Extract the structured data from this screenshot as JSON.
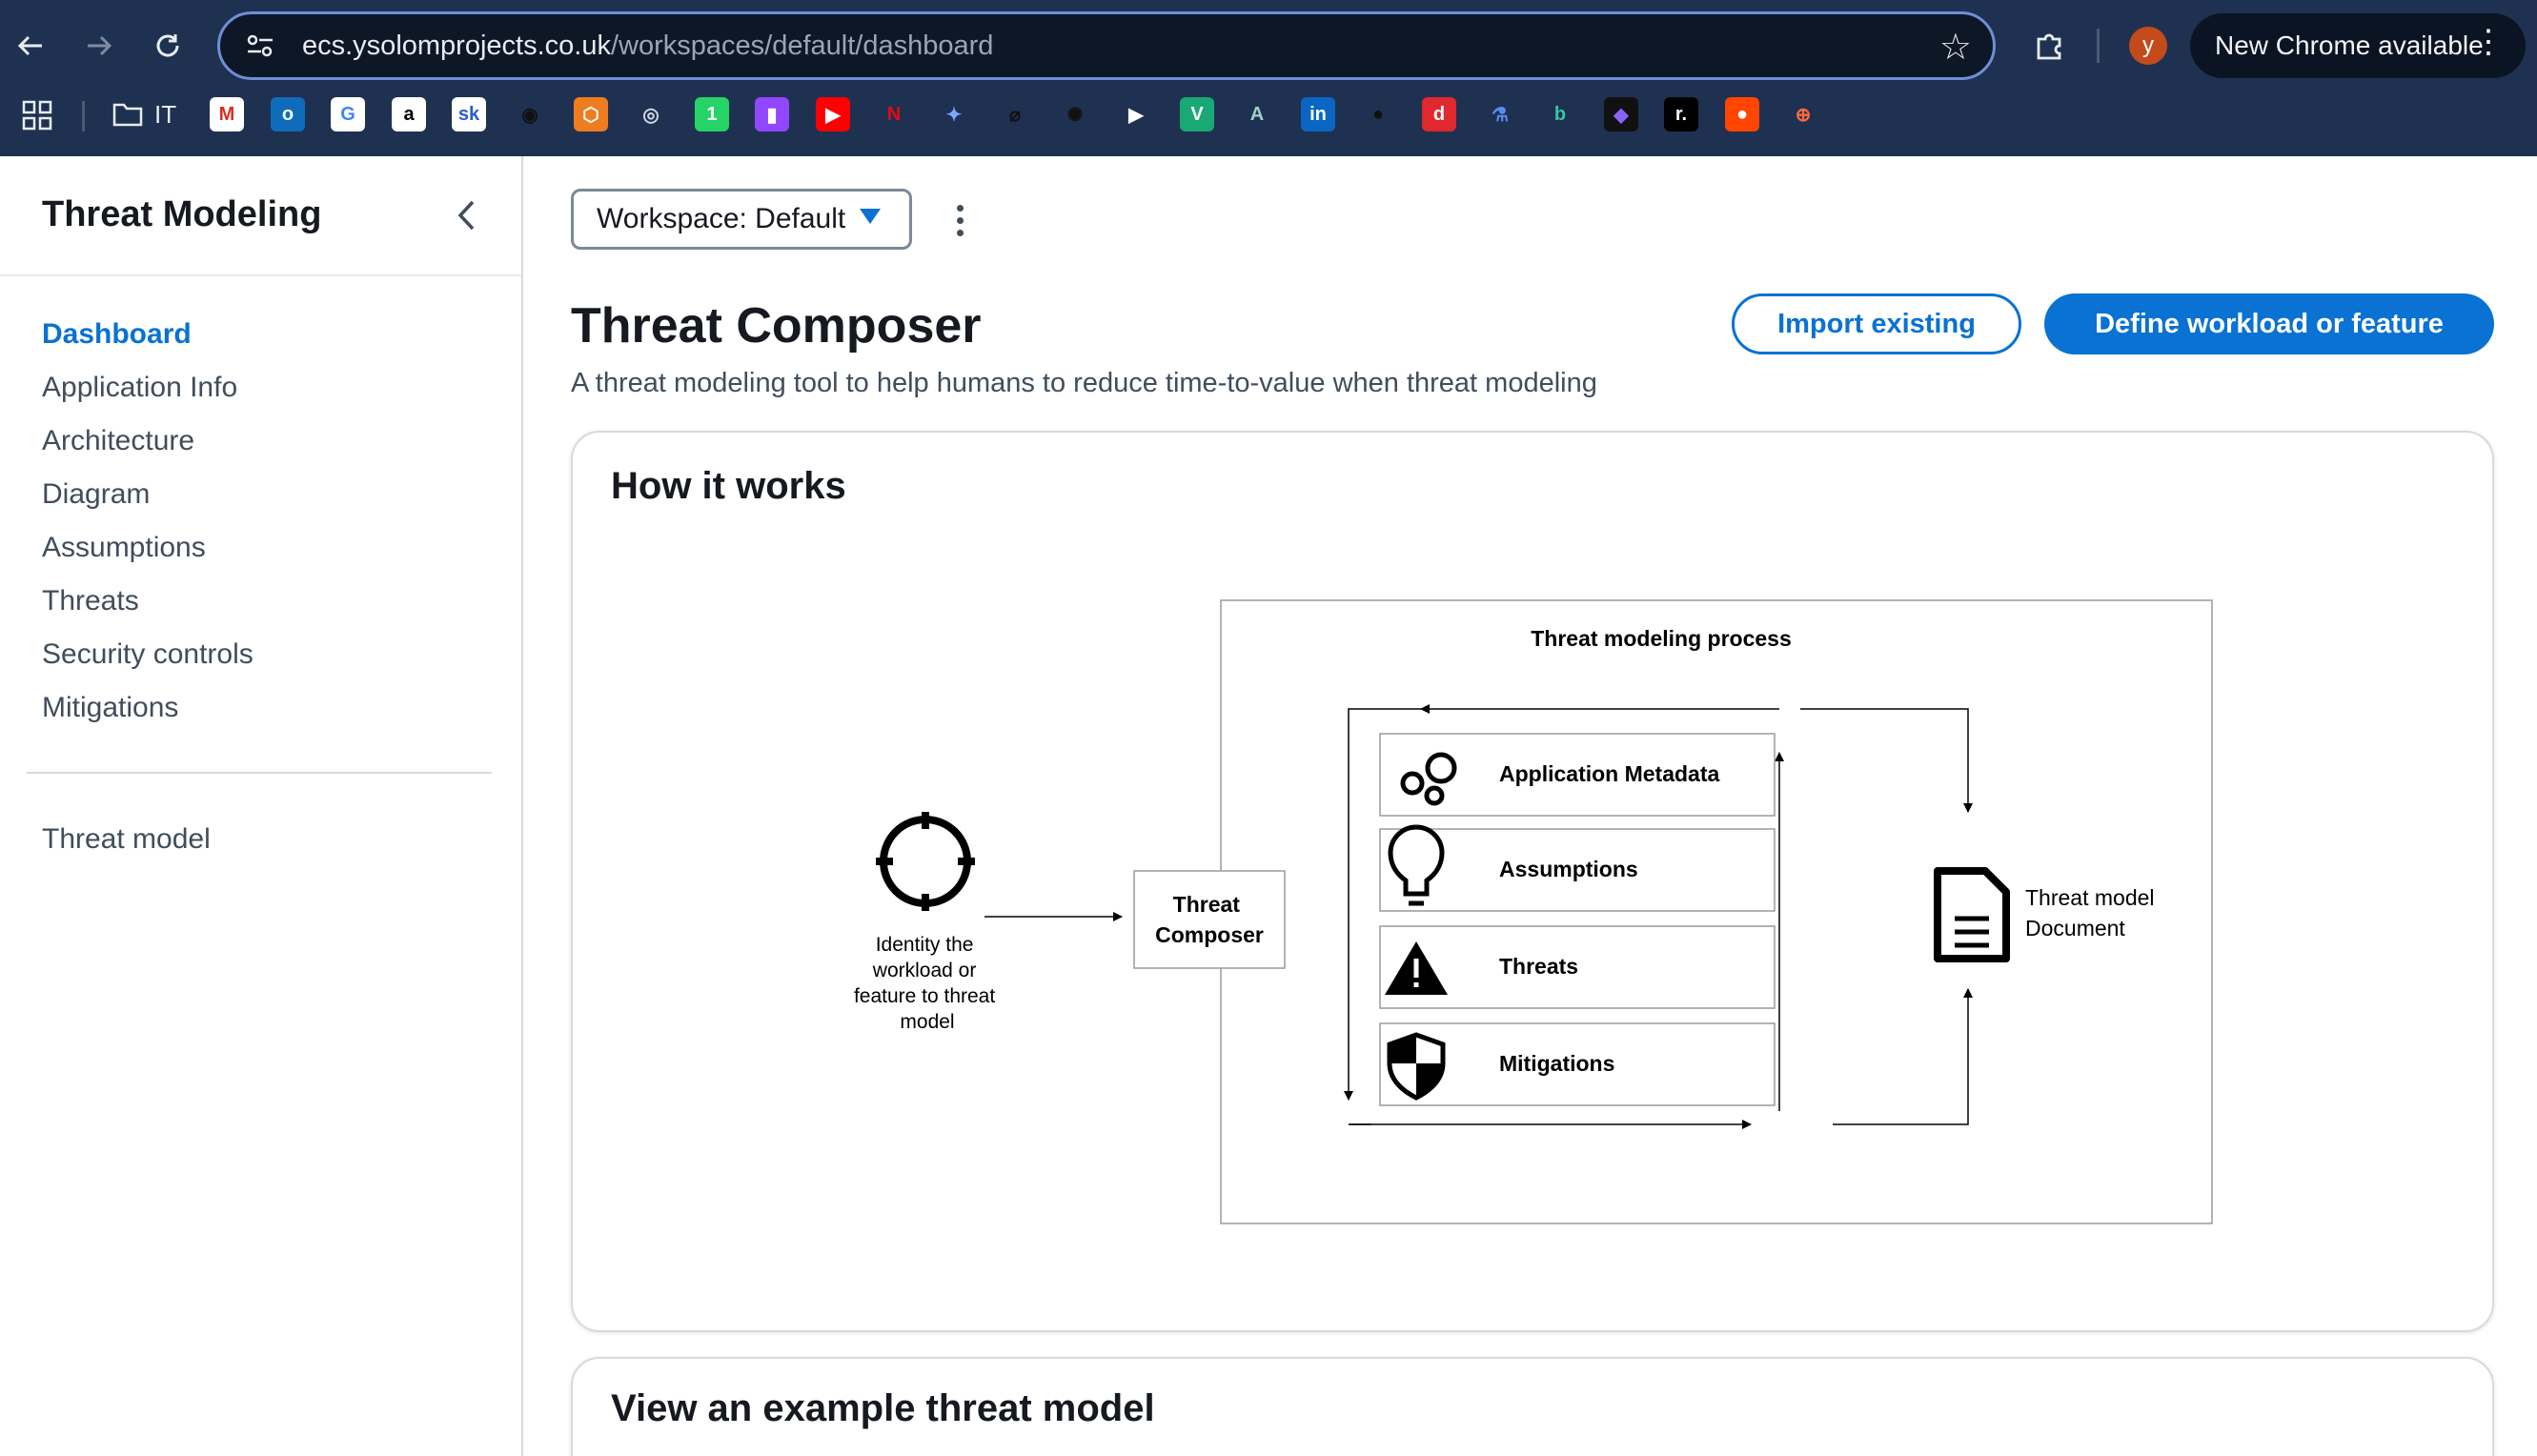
{
  "browser": {
    "url_host": "ecs.ysolomprojects.co.uk",
    "url_path": "/workspaces/default/dashboard",
    "profile_initial": "y",
    "update_label": "New Chrome available",
    "bookmark_folder": "IT",
    "bookmarks": [
      {
        "name": "gmail",
        "glyph": "M",
        "color": "#ffffff",
        "fg": "#d93025"
      },
      {
        "name": "outlook",
        "glyph": "o",
        "color": "#0f6cbd",
        "fg": "#ffffff"
      },
      {
        "name": "google",
        "glyph": "G",
        "color": "#ffffff",
        "fg": "#4285f4"
      },
      {
        "name": "amazon",
        "glyph": "a",
        "color": "#ffffff",
        "fg": "#000000"
      },
      {
        "name": "skool",
        "glyph": "sk",
        "color": "#ffffff",
        "fg": "#2a5bd7"
      },
      {
        "name": "github",
        "glyph": "◉",
        "color": "#1f3150",
        "fg": "#111111"
      },
      {
        "name": "aws-box",
        "glyph": "⬡",
        "color": "#ed7d1f",
        "fg": "#ffffff"
      },
      {
        "name": "circle-app",
        "glyph": "◎",
        "color": "#1f3150",
        "fg": "#cfd6e2"
      },
      {
        "name": "whatsapp",
        "glyph": "1",
        "color": "#25d366",
        "fg": "#ffffff"
      },
      {
        "name": "twitch",
        "glyph": "▮",
        "color": "#9146ff",
        "fg": "#ffffff"
      },
      {
        "name": "youtube",
        "glyph": "▶",
        "color": "#ff0000",
        "fg": "#ffffff"
      },
      {
        "name": "netflix",
        "glyph": "N",
        "color": "#1f3150",
        "fg": "#e50914"
      },
      {
        "name": "gemini",
        "glyph": "✦",
        "color": "#1f3150",
        "fg": "#7aa7ff"
      },
      {
        "name": "perplexity",
        "glyph": "⌀",
        "color": "#1f3150",
        "fg": "#111111"
      },
      {
        "name": "openai",
        "glyph": "✺",
        "color": "#1f3150",
        "fg": "#111111"
      },
      {
        "name": "play",
        "glyph": "▶",
        "color": "#1f3150",
        "fg": "#ffffff"
      },
      {
        "name": "v-app",
        "glyph": "V",
        "color": "#19a974",
        "fg": "#ffffff"
      },
      {
        "name": "a-app",
        "glyph": "A",
        "color": "#1f3150",
        "fg": "#9fd0c8"
      },
      {
        "name": "linkedin",
        "glyph": "in",
        "color": "#0a66c2",
        "fg": "#ffffff"
      },
      {
        "name": "dark-circle",
        "glyph": "●",
        "color": "#1f3150",
        "fg": "#111111"
      },
      {
        "name": "d-app",
        "glyph": "d",
        "color": "#e0282e",
        "fg": "#ffffff"
      },
      {
        "name": "lab-flask",
        "glyph": "⚗",
        "color": "#1f3150",
        "fg": "#5b8def"
      },
      {
        "name": "b-app",
        "glyph": "b",
        "color": "#1f3150",
        "fg": "#37c7a0"
      },
      {
        "name": "purple-app",
        "glyph": "◆",
        "color": "#111111",
        "fg": "#8a63ff"
      },
      {
        "name": "r-app",
        "glyph": "r.",
        "color": "#000000",
        "fg": "#ffffff"
      },
      {
        "name": "reddit",
        "glyph": "●",
        "color": "#ff4500",
        "fg": "#ffffff"
      },
      {
        "name": "toolbox",
        "glyph": "⊕",
        "color": "#1f3150",
        "fg": "#ff6a3d"
      }
    ]
  },
  "sidebar": {
    "title": "Threat Modeling",
    "items": [
      {
        "label": "Dashboard",
        "active": true
      },
      {
        "label": "Application Info",
        "active": false
      },
      {
        "label": "Architecture",
        "active": false
      },
      {
        "label": "Diagram",
        "active": false
      },
      {
        "label": "Assumptions",
        "active": false
      },
      {
        "label": "Threats",
        "active": false
      },
      {
        "label": "Security controls",
        "active": false
      },
      {
        "label": "Mitigations",
        "active": false
      }
    ],
    "secondary_items": [
      {
        "label": "Threat model"
      }
    ]
  },
  "workspace": {
    "label": "Workspace: Default"
  },
  "header": {
    "title": "Threat Composer",
    "description": "A threat modeling tool to help humans to reduce time-to-value when threat modeling",
    "import_label": "Import existing",
    "define_label": "Define workload or feature"
  },
  "how_it_works": {
    "title": "How it works",
    "diagram": {
      "process_title": "Threat modeling process",
      "identify_label_lines": [
        "Identity the",
        "workload or",
        "feature to threat",
        "model"
      ],
      "composer_label_lines": [
        "Threat",
        "Composer"
      ],
      "steps": [
        {
          "label": "Application Metadata",
          "icon": "app-metadata-icon"
        },
        {
          "label": "Assumptions",
          "icon": "lightbulb-icon"
        },
        {
          "label": "Threats",
          "icon": "warning-icon"
        },
        {
          "label": "Mitigations",
          "icon": "shield-icon"
        }
      ],
      "output_label_lines": [
        "Threat model",
        "Document"
      ]
    }
  },
  "example": {
    "title": "View an example threat model"
  },
  "colors": {
    "accent": "#0972d3",
    "chrome": "#1f3150",
    "text": "#16191f",
    "muted": "#414d5c"
  }
}
